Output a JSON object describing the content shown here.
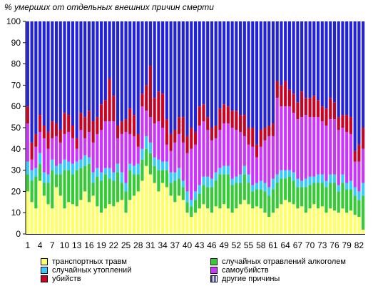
{
  "chart_data": {
    "type": "bar",
    "stacked": true,
    "percent": true,
    "title": "% умерших  от отдельных внешних причин смерти",
    "ylim": [
      0,
      100
    ],
    "y_ticks": [
      "0",
      "10",
      "20",
      "30",
      "40",
      "50",
      "60",
      "70",
      "80",
      "90",
      "100"
    ],
    "x_tick_labels": [
      "1",
      "4",
      "7",
      "10",
      "13",
      "16",
      "19",
      "22",
      "25",
      "28",
      "31",
      "34",
      "37",
      "40",
      "43",
      "46",
      "49",
      "52",
      "55",
      "58",
      "61",
      "64",
      "67",
      "70",
      "73",
      "76",
      "79",
      "82"
    ],
    "categories": [
      "1",
      "2",
      "3",
      "4",
      "5",
      "6",
      "7",
      "8",
      "9",
      "10",
      "11",
      "12",
      "13",
      "14",
      "15",
      "16",
      "17",
      "18",
      "19",
      "20",
      "21",
      "22",
      "23",
      "24",
      "25",
      "26",
      "27",
      "28",
      "29",
      "30",
      "31",
      "32",
      "33",
      "34",
      "35",
      "36",
      "37",
      "38",
      "39",
      "40",
      "41",
      "42",
      "43",
      "44",
      "45",
      "46",
      "47",
      "48",
      "49",
      "50",
      "51",
      "52",
      "53",
      "54",
      "55",
      "56",
      "57",
      "58",
      "59",
      "60",
      "61",
      "62",
      "63",
      "64",
      "65",
      "66",
      "67",
      "68",
      "69",
      "70",
      "71",
      "72",
      "73",
      "74",
      "75",
      "76",
      "77",
      "78",
      "79",
      "80",
      "81",
      "82",
      "83"
    ],
    "legend_position": "bottom",
    "grid": false,
    "series": [
      {
        "name": "транспортных травм",
        "color": "#ffff66",
        "values": [
          20,
          15,
          12,
          25,
          18,
          14,
          12,
          22,
          18,
          12,
          15,
          14,
          13,
          16,
          20,
          15,
          18,
          13,
          10,
          12,
          14,
          13,
          15,
          16,
          10,
          16,
          18,
          20,
          25,
          32,
          28,
          24,
          20,
          24,
          22,
          18,
          15,
          18,
          16,
          10,
          8,
          10,
          12,
          14,
          12,
          10,
          13,
          12,
          14,
          12,
          10,
          12,
          14,
          16,
          14,
          12,
          13,
          12,
          10,
          8,
          10,
          12,
          14,
          16,
          15,
          14,
          12,
          13,
          10,
          12,
          14,
          12,
          13,
          10,
          12,
          11,
          10,
          12,
          10,
          11,
          9,
          8,
          2
        ]
      },
      {
        "name": "случайных отравлений алкоголем",
        "color": "#33cc33",
        "values": [
          8,
          10,
          15,
          8,
          6,
          10,
          18,
          6,
          10,
          18,
          15,
          14,
          17,
          15,
          12,
          18,
          6,
          14,
          15,
          16,
          12,
          12,
          14,
          8,
          10,
          14,
          10,
          8,
          10,
          8,
          10,
          8,
          10,
          6,
          8,
          6,
          10,
          8,
          6,
          5,
          5,
          6,
          7,
          9,
          10,
          12,
          12,
          16,
          14,
          16,
          13,
          12,
          10,
          12,
          10,
          8,
          8,
          9,
          10,
          10,
          11,
          12,
          12,
          10,
          12,
          11,
          10,
          9,
          12,
          11,
          10,
          12,
          11,
          12,
          12,
          13,
          10,
          12,
          11,
          10,
          9,
          8,
          16
        ]
      },
      {
        "name": "случайных утоплений",
        "color": "#33ccff",
        "values": [
          6,
          5,
          4,
          5,
          5,
          4,
          5,
          4,
          5,
          5,
          4,
          5,
          4,
          4,
          5,
          3,
          5,
          4,
          4,
          3,
          5,
          4,
          4,
          5,
          4,
          3,
          4,
          5,
          5,
          6,
          5,
          4,
          5,
          4,
          4,
          5,
          4,
          5,
          3,
          5,
          3,
          4,
          4,
          4,
          5,
          4,
          4,
          3,
          4,
          4,
          3,
          3,
          4,
          4,
          4,
          3,
          3,
          4,
          4,
          4,
          5,
          4,
          4,
          4,
          3,
          4,
          4,
          3,
          4,
          4,
          3,
          4,
          4,
          3,
          4,
          4,
          3,
          4,
          3,
          4,
          4,
          4,
          6
        ]
      },
      {
        "name": "самоубийств",
        "color": "#cc33ff",
        "values": [
          18,
          5,
          10,
          10,
          16,
          12,
          10,
          14,
          10,
          12,
          14,
          12,
          6,
          14,
          8,
          12,
          14,
          16,
          20,
          22,
          22,
          24,
          12,
          18,
          24,
          14,
          14,
          8,
          20,
          12,
          12,
          16,
          18,
          16,
          8,
          10,
          14,
          16,
          18,
          18,
          24,
          22,
          28,
          26,
          22,
          18,
          16,
          18,
          20,
          20,
          24,
          22,
          20,
          14,
          14,
          18,
          12,
          16,
          20,
          24,
          20,
          36,
          30,
          30,
          30,
          28,
          28,
          30,
          30,
          28,
          28,
          27,
          25,
          26,
          26,
          26,
          26,
          22,
          24,
          22,
          12,
          14,
          16
        ]
      },
      {
        "name": "убийств",
        "color": "#cc0022",
        "values": [
          8,
          8,
          6,
          8,
          6,
          8,
          8,
          6,
          6,
          10,
          8,
          6,
          5,
          8,
          10,
          10,
          10,
          8,
          12,
          10,
          20,
          12,
          6,
          6,
          6,
          12,
          10,
          6,
          6,
          12,
          24,
          12,
          14,
          16,
          12,
          8,
          6,
          8,
          12,
          8,
          10,
          6,
          9,
          8,
          6,
          6,
          6,
          10,
          9,
          8,
          8,
          9,
          8,
          10,
          8,
          9,
          6,
          8,
          6,
          5,
          6,
          8,
          10,
          12,
          8,
          9,
          8,
          12,
          8,
          9,
          10,
          8,
          7,
          8,
          10,
          8,
          6,
          6,
          8,
          8,
          5,
          8,
          10
        ]
      },
      {
        "name": "другие причины",
        "color": "#2222dd",
        "values": []
      }
    ]
  },
  "legend": {
    "items": [
      {
        "label": "транспортных травм",
        "color": "#ffff66"
      },
      {
        "label": "случайных отравлений алкоголем",
        "color": "#33cc33"
      },
      {
        "label": "случайных утоплений",
        "color": "#33ccff"
      },
      {
        "label": "самоубийств",
        "color": "#cc33ff"
      },
      {
        "label": "убийств",
        "color": "#cc0022"
      },
      {
        "label": "другие причины",
        "color": "#ffffff",
        "pattern_color": "#2222dd"
      }
    ]
  }
}
